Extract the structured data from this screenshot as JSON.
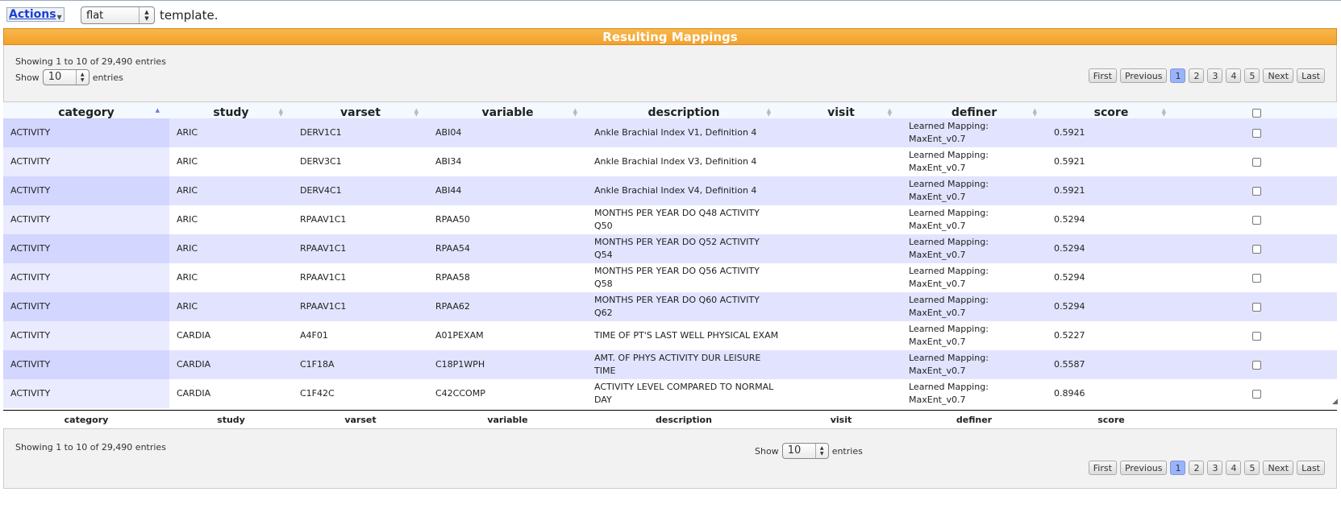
{
  "toolbar": {
    "actions_label": "Actions",
    "template_select_value": "flat",
    "template_suffix": "template."
  },
  "panel": {
    "title": "Resulting Mappings"
  },
  "info_text": "Showing 1 to 10 of 29,490 entries",
  "length": {
    "prefix": "Show",
    "value": "10",
    "suffix": "entries"
  },
  "pager": {
    "first": "First",
    "previous": "Previous",
    "pages": [
      "1",
      "2",
      "3",
      "4",
      "5"
    ],
    "active_page": "1",
    "next": "Next",
    "last": "Last"
  },
  "columns": [
    "category",
    "study",
    "varset",
    "variable",
    "description",
    "visit",
    "definer",
    "score"
  ],
  "rows": [
    [
      "ACTIVITY",
      "ARIC",
      "DERV1C1",
      "ABI04",
      "Ankle Brachial Index V1, Definition 4",
      "",
      "Learned Mapping: MaxEnt_v0.7",
      "0.5921"
    ],
    [
      "ACTIVITY",
      "ARIC",
      "DERV3C1",
      "ABI34",
      "Ankle Brachial Index V3, Definition 4",
      "",
      "Learned Mapping: MaxEnt_v0.7",
      "0.5921"
    ],
    [
      "ACTIVITY",
      "ARIC",
      "DERV4C1",
      "ABI44",
      "Ankle Brachial Index V4, Definition 4",
      "",
      "Learned Mapping: MaxEnt_v0.7",
      "0.5921"
    ],
    [
      "ACTIVITY",
      "ARIC",
      "RPAAV1C1",
      "RPAA50",
      "MONTHS PER YEAR DO Q48 ACTIVITY Q50",
      "",
      "Learned Mapping: MaxEnt_v0.7",
      "0.5294"
    ],
    [
      "ACTIVITY",
      "ARIC",
      "RPAAV1C1",
      "RPAA54",
      "MONTHS PER YEAR DO Q52 ACTIVITY Q54",
      "",
      "Learned Mapping: MaxEnt_v0.7",
      "0.5294"
    ],
    [
      "ACTIVITY",
      "ARIC",
      "RPAAV1C1",
      "RPAA58",
      "MONTHS PER YEAR DO Q56 ACTIVITY Q58",
      "",
      "Learned Mapping: MaxEnt_v0.7",
      "0.5294"
    ],
    [
      "ACTIVITY",
      "ARIC",
      "RPAAV1C1",
      "RPAA62",
      "MONTHS PER YEAR DO Q60 ACTIVITY Q62",
      "",
      "Learned Mapping: MaxEnt_v0.7",
      "0.5294"
    ],
    [
      "ACTIVITY",
      "CARDIA",
      "A4F01",
      "A01PEXAM",
      "TIME OF PT'S LAST WELL PHYSICAL EXAM",
      "",
      "Learned Mapping: MaxEnt_v0.7",
      "0.5227"
    ],
    [
      "ACTIVITY",
      "CARDIA",
      "C1F18A",
      "C18P1WPH",
      "AMT. OF PHYS ACTIVITY DUR LEISURE TIME",
      "",
      "Learned Mapping: MaxEnt_v0.7",
      "0.5587"
    ],
    [
      "ACTIVITY",
      "CARDIA",
      "C1F42C",
      "C42CCOMP",
      "ACTIVITY LEVEL COMPARED TO NORMAL DAY",
      "",
      "Learned Mapping: MaxEnt_v0.7",
      "0.8946"
    ]
  ]
}
